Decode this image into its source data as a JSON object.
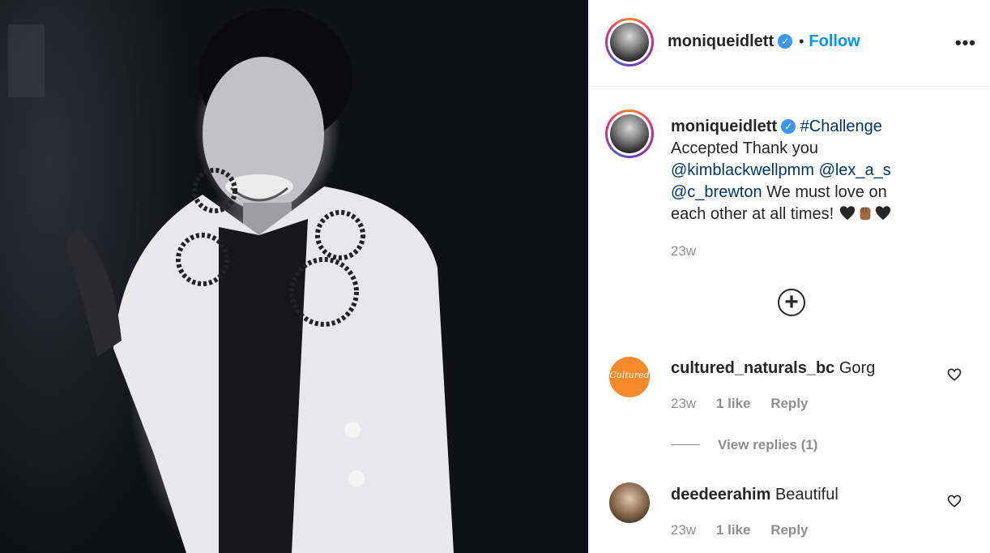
{
  "post": {
    "author": "moniqueidlett",
    "follow_label": "Follow",
    "separator": "•",
    "more_label": "•••"
  },
  "caption": {
    "author": "moniqueidlett",
    "hashtag": "#Challenge",
    "text1": "Accepted Thank you",
    "mention1": "@kimblackwellpmm",
    "mention2": "@lex_a_s",
    "mention3": "@c_brewton",
    "text2": " We must love on each other at all times!",
    "time": "23w"
  },
  "comments": [
    {
      "username": "cultured_naturals_bc",
      "text": "Gorg",
      "time": "23w",
      "likes": "1 like",
      "reply_label": "Reply",
      "view_replies": "View replies (1)",
      "avatar_text": "Cultured"
    },
    {
      "username": "deedeerahim",
      "text": "Beautiful",
      "time": "23w",
      "likes": "1 like",
      "reply_label": "Reply"
    }
  ],
  "icons": {
    "verified": "verified-badge-icon",
    "more": "more-options-icon",
    "add": "add-circle-icon",
    "heart": "heart-outline-icon"
  },
  "colors": {
    "follow": "#0095f6",
    "link": "#00376b",
    "muted": "#8e8e8e",
    "verified": "#3897f0"
  }
}
